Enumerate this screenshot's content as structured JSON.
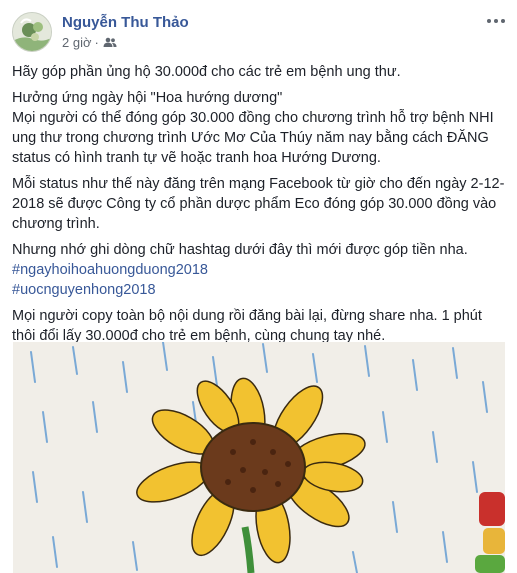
{
  "post": {
    "author": "Nguyễn Thu Thảo",
    "time": "2 giờ",
    "separator": "·",
    "privacy_icon": "friends-icon",
    "more_icon": "more-options-icon",
    "paragraphs": [
      {
        "lines": [
          "Hãy góp phần ủng hộ 30.000đ cho các trẻ em bệnh ung thư."
        ]
      },
      {
        "lines": [
          "Hưởng ứng ngày hội \"Hoa hướng dương\"",
          "Mọi người có thể đóng góp 30.000 đồng cho chương trình hỗ trợ bệnh NHI",
          "ung thư trong chương trình Ước Mơ Của Thúy năm nay bằng cách ĐĂNG",
          "status có hình tranh tự vẽ hoặc tranh hoa Hướng Dương."
        ]
      },
      {
        "lines": [
          "Mỗi status như thế này đăng trên mạng Facebook từ giờ cho đến ngày 2-12-",
          "2018 sẽ được Công ty cổ phần dược phẩm Eco đóng góp 30.000 đồng vào",
          "chương trình."
        ]
      },
      {
        "lines": [
          "Nhưng nhớ ghi dòng chữ hashtag dưới đây thì mới được góp tiền nha."
        ],
        "hashtags": [
          "#ngayhoihoahuongduong2018",
          "#uocnguyenhong2018"
        ]
      },
      {
        "lines": [
          "Mọi người copy toàn bộ nội dung rồi đăng bài lại, đừng share nha. 1 phút",
          "thôi đổi lấy 30.000đ cho trẻ em bệnh, cùng chung tay nhé."
        ]
      }
    ],
    "photo": {
      "subject": "sunflower-drawing",
      "colors": {
        "petal": "#f2c230",
        "petal_edge": "#3a2a10",
        "center": "#6b3a1c",
        "rain": "#7aa9d6",
        "stem": "#3f8f3a",
        "paper": "#f1eee8"
      }
    },
    "colors": {
      "link": "#385898",
      "text": "#1d2129",
      "meta": "#606770"
    }
  }
}
